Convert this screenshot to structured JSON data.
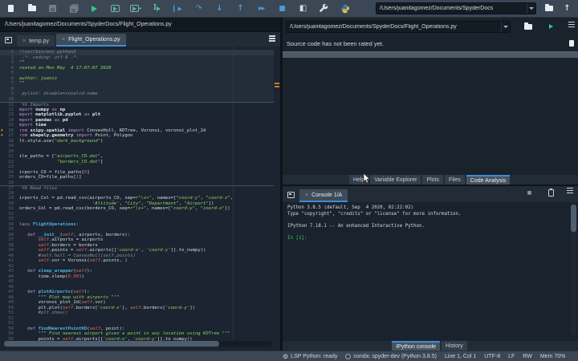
{
  "toolbar": {
    "cwd": "/Users/juanitagomez/Documents/SpyderDocs",
    "icons": [
      {
        "name": "new-file"
      },
      {
        "name": "open-file"
      },
      {
        "name": "save"
      },
      {
        "name": "save-all"
      },
      {
        "name": "run-file"
      },
      {
        "name": "run-cell"
      },
      {
        "name": "run-cell-advance"
      },
      {
        "name": "run-selection"
      },
      {
        "name": "debug-file"
      },
      {
        "name": "step-over"
      },
      {
        "name": "step-into"
      },
      {
        "name": "step-out"
      },
      {
        "name": "debug-continue"
      },
      {
        "name": "stop"
      },
      {
        "name": "maximize-pane"
      },
      {
        "name": "preferences"
      },
      {
        "name": "python-path-manager"
      }
    ]
  },
  "editor": {
    "path": "/Users/juanitagomez/Documents/SpyderDocs/Flight_Operations.py",
    "tabs": [
      {
        "label": "temp.py",
        "active": false
      },
      {
        "label": "Flight_Operations.py",
        "active": true
      }
    ],
    "lines": [
      {
        "n": 1,
        "cell": "a",
        "cur": true,
        "segs": [
          [
            "c",
            "!/usr/bin/env python3"
          ]
        ]
      },
      {
        "n": 2,
        "cell": "a",
        "segs": [
          [
            "c",
            " -*- coding: utf-8 -*-"
          ]
        ]
      },
      {
        "n": 3,
        "cell": "a",
        "segs": [
          [
            "s",
            "\"\""
          ]
        ]
      },
      {
        "n": 4,
        "cell": "a",
        "segs": [
          [
            "s",
            "reated on Mon May  4 17:07:07 2020"
          ]
        ]
      },
      {
        "n": 5,
        "cell": "a",
        "segs": []
      },
      {
        "n": 6,
        "cell": "a",
        "segs": [
          [
            "s",
            "author: juanis"
          ]
        ]
      },
      {
        "n": 7,
        "cell": "a",
        "segs": [
          [
            "s",
            "\"\""
          ]
        ]
      },
      {
        "n": 8,
        "cell": "a",
        "segs": []
      },
      {
        "n": 9,
        "cell": "a",
        "segs": [
          [
            "c",
            " pylint: disable=invalid-name"
          ]
        ]
      },
      {
        "n": 10,
        "cell": "a",
        "segs": []
      },
      {
        "n": 11,
        "div": true,
        "segs": [
          [
            "c",
            " %% Imports"
          ]
        ]
      },
      {
        "n": 12,
        "segs": [
          [
            "k",
            "mport "
          ],
          [
            "b",
            "numpy "
          ],
          [
            "k",
            "as "
          ],
          [
            "b",
            "np"
          ]
        ]
      },
      {
        "n": 13,
        "segs": [
          [
            "k",
            "mport "
          ],
          [
            "b",
            "matplotlib.pyplot "
          ],
          [
            "k",
            "as "
          ],
          [
            "b",
            "plt"
          ]
        ]
      },
      {
        "n": 14,
        "segs": [
          [
            "k",
            "mport "
          ],
          [
            "b",
            "pandas "
          ],
          [
            "k",
            "as "
          ],
          [
            "b",
            "pd"
          ]
        ]
      },
      {
        "n": 15,
        "segs": [
          [
            "k",
            "mport "
          ],
          [
            "b",
            "time"
          ]
        ]
      },
      {
        "n": 16,
        "warn": true,
        "segs": [
          [
            "k",
            "rom "
          ],
          [
            "b",
            "scipy.spatial "
          ],
          [
            "k",
            "import "
          ],
          [
            "d",
            "ConvexHull, KDTree, Voronoi, voronoi_plot_2d"
          ]
        ]
      },
      {
        "n": 17,
        "warn": true,
        "segs": [
          [
            "k",
            "rom "
          ],
          [
            "b",
            "shapely.geometry "
          ],
          [
            "k",
            "import "
          ],
          [
            "d",
            "Point, Polygon"
          ]
        ]
      },
      {
        "n": 18,
        "segs": [
          [
            "d",
            "lt.style.use("
          ],
          [
            "s",
            "\"dark_background\""
          ],
          [
            "d",
            ")"
          ]
        ]
      },
      {
        "n": 19,
        "segs": []
      },
      {
        "n": 20,
        "segs": []
      },
      {
        "n": 21,
        "segs": [
          [
            "d",
            "ile_paths = ["
          ],
          [
            "s",
            "\"airports_CO.dat\""
          ],
          [
            "d",
            ","
          ]
        ]
      },
      {
        "n": 22,
        "segs": [
          [
            "s",
            "              \"borders_CO.dat\""
          ],
          [
            "d",
            "]"
          ]
        ]
      },
      {
        "n": 23,
        "segs": []
      },
      {
        "n": 24,
        "segs": [
          [
            "d",
            "irports_CO = file_paths["
          ],
          [
            "n2",
            "0"
          ],
          [
            "d",
            "]"
          ]
        ]
      },
      {
        "n": 25,
        "segs": [
          [
            "d",
            "orders_CO=file_paths["
          ],
          [
            "n2",
            "1"
          ],
          [
            "d",
            "]"
          ]
        ]
      },
      {
        "n": 26,
        "segs": []
      },
      {
        "n": 27,
        "div": true,
        "segs": [
          [
            "c",
            " %% Read files"
          ]
        ]
      },
      {
        "n": 28,
        "segs": []
      },
      {
        "n": 29,
        "segs": [
          [
            "d",
            "irports_Col = pd.read_csv(airports_CO, sep="
          ],
          [
            "s",
            "r\"\\s+\""
          ],
          [
            "d",
            ", names=["
          ],
          [
            "s",
            "\"coord-y\""
          ],
          [
            "d",
            ", "
          ],
          [
            "s",
            "\"coord-x\""
          ],
          [
            "d",
            ","
          ]
        ]
      },
      {
        "n": 30,
        "segs": [
          [
            "s",
            "                           'Altitude'"
          ],
          [
            "d",
            ", "
          ],
          [
            "s",
            "\"City\""
          ],
          [
            "d",
            ", "
          ],
          [
            "s",
            "\"Department\""
          ],
          [
            "d",
            ", "
          ],
          [
            "s",
            "\"Airport\""
          ],
          [
            "d",
            "])"
          ]
        ]
      },
      {
        "n": 31,
        "segs": [
          [
            "d",
            "orders_Col = pd.read_csv(borders_CO, sep="
          ],
          [
            "s",
            "r\"\\s+\""
          ],
          [
            "d",
            ", names=["
          ],
          [
            "s",
            "\"coord-y\""
          ],
          [
            "d",
            ", "
          ],
          [
            "s",
            "\"coord-x\""
          ],
          [
            "d",
            "])"
          ]
        ]
      },
      {
        "n": 32,
        "segs": []
      },
      {
        "n": 33,
        "segs": []
      },
      {
        "n": 34,
        "segs": [
          [
            "k",
            "lass "
          ],
          [
            "f",
            "FlightOperations"
          ],
          [
            "d",
            ":"
          ]
        ]
      },
      {
        "n": 35,
        "segs": []
      },
      {
        "n": 36,
        "segs": [
          [
            "d",
            "   "
          ],
          [
            "k",
            "def "
          ],
          [
            "f",
            "__init__"
          ],
          [
            "d",
            "("
          ],
          [
            "o",
            "self"
          ],
          [
            "d",
            ", airports, borders):"
          ]
        ]
      },
      {
        "n": 37,
        "segs": [
          [
            "d",
            "       "
          ],
          [
            "o",
            "self"
          ],
          [
            "d",
            ".airports = airports"
          ]
        ]
      },
      {
        "n": 38,
        "segs": [
          [
            "d",
            "       "
          ],
          [
            "o",
            "self"
          ],
          [
            "d",
            ".borders = borders"
          ]
        ]
      },
      {
        "n": 39,
        "segs": [
          [
            "d",
            "       "
          ],
          [
            "o",
            "self"
          ],
          [
            "d",
            ".points = "
          ],
          [
            "o",
            "self"
          ],
          [
            "d",
            ".airports[["
          ],
          [
            "s",
            "'coord-x'"
          ],
          [
            "d",
            ", "
          ],
          [
            "s",
            "'coord-y'"
          ],
          [
            "d",
            "]].to_numpy()"
          ]
        ]
      },
      {
        "n": 40,
        "segs": [
          [
            "d",
            "       "
          ],
          [
            "c",
            "#self.hull = ConvexHull(self.points)"
          ]
        ]
      },
      {
        "n": 41,
        "segs": [
          [
            "d",
            "       "
          ],
          [
            "o",
            "self"
          ],
          [
            "d",
            ".vor = Voronoi("
          ],
          [
            "o",
            "self"
          ],
          [
            "d",
            ".points, )"
          ]
        ]
      },
      {
        "n": 42,
        "segs": []
      },
      {
        "n": 43,
        "segs": [
          [
            "d",
            "   "
          ],
          [
            "k",
            "def "
          ],
          [
            "f",
            "sleep_wrapper"
          ],
          [
            "d",
            "("
          ],
          [
            "o",
            "self"
          ],
          [
            "d",
            "):"
          ]
        ]
      },
      {
        "n": 44,
        "segs": [
          [
            "d",
            "       time.sleep("
          ],
          [
            "n2",
            "0.003"
          ],
          [
            "d",
            ")"
          ]
        ]
      },
      {
        "n": 45,
        "segs": []
      },
      {
        "n": 46,
        "segs": []
      },
      {
        "n": 47,
        "segs": [
          [
            "d",
            "   "
          ],
          [
            "k",
            "def "
          ],
          [
            "f",
            "plotAirports"
          ],
          [
            "d",
            "("
          ],
          [
            "o",
            "self"
          ],
          [
            "d",
            "):"
          ]
        ]
      },
      {
        "n": 48,
        "segs": [
          [
            "d",
            "       "
          ],
          [
            "s",
            "\"\"\" Plot map with airports \"\"\""
          ]
        ]
      },
      {
        "n": 49,
        "segs": [
          [
            "d",
            "       voronoi_plot_2d("
          ],
          [
            "o",
            "self"
          ],
          [
            "d",
            ".vor)"
          ]
        ]
      },
      {
        "n": 50,
        "segs": [
          [
            "d",
            "       plt.plot("
          ],
          [
            "o",
            "self"
          ],
          [
            "d",
            ".borders["
          ],
          [
            "s",
            "'coord-x'"
          ],
          [
            "d",
            "], "
          ],
          [
            "o",
            "self"
          ],
          [
            "d",
            ".borders["
          ],
          [
            "s",
            "'coord-y'"
          ],
          [
            "d",
            "])"
          ]
        ]
      },
      {
        "n": 51,
        "segs": [
          [
            "d",
            "       "
          ],
          [
            "c",
            "#plt.show()"
          ]
        ]
      },
      {
        "n": 52,
        "segs": []
      },
      {
        "n": 53,
        "segs": []
      },
      {
        "n": 54,
        "segs": [
          [
            "d",
            "   "
          ],
          [
            "k",
            "def "
          ],
          [
            "f",
            "findNearestPointKD"
          ],
          [
            "d",
            "("
          ],
          [
            "o",
            "self"
          ],
          [
            "d",
            ", point):"
          ]
        ]
      },
      {
        "n": 55,
        "segs": [
          [
            "d",
            "       "
          ],
          [
            "s",
            "\"\"\" Find nearest airport given a point in any location using KDTree \"\"\""
          ]
        ]
      },
      {
        "n": 56,
        "segs": [
          [
            "d",
            "       points = "
          ],
          [
            "o",
            "self"
          ],
          [
            "d",
            ".airports[["
          ],
          [
            "s",
            "'coord-x'"
          ],
          [
            "d",
            ", "
          ],
          [
            "s",
            "'coord-y'"
          ],
          [
            "d",
            "]].to_numpy()"
          ]
        ]
      },
      {
        "n": 57,
        "segs": []
      }
    ]
  },
  "analysis": {
    "file": "/Users/juanitagomez/Documents/SpyderDocs/Flight_Operations.py",
    "message": "Source code has not been rated yet.",
    "tabs": [
      {
        "label": "Help"
      },
      {
        "label": "Variable Explorer"
      },
      {
        "label": "Plots"
      },
      {
        "label": "Files"
      },
      {
        "label": "Code Analysis",
        "active": true
      }
    ]
  },
  "console": {
    "tab_label": "Console 1/A",
    "output": [
      "Python 3.8.5 (default, Sep  4 2020, 02:22:02) ",
      "Type \"copyright\", \"credits\" or \"license\" for more information.",
      "",
      "IPython 7.18.1 -- An enhanced Interactive Python.",
      ""
    ],
    "prompt": "In [1]: ",
    "tabs": [
      {
        "label": "IPython console",
        "active": true
      },
      {
        "label": "History"
      }
    ]
  },
  "statusbar": {
    "items": [
      {
        "icon": "lsp",
        "label": "LSP Python: ready"
      },
      {
        "icon": "conda",
        "label": "conda: spyder-dev (Python 3.8.5)"
      },
      {
        "label": "Line 1, Col 1"
      },
      {
        "label": "UTF-8"
      },
      {
        "label": "LF"
      },
      {
        "label": "RW"
      },
      {
        "label": "Mem 70%"
      }
    ]
  },
  "colors": {
    "accent_blue": "#3f8cd6",
    "run_green": "#2fc98c",
    "warning_orange": "#e8903a",
    "prompt_green": "#3ecb5a"
  }
}
